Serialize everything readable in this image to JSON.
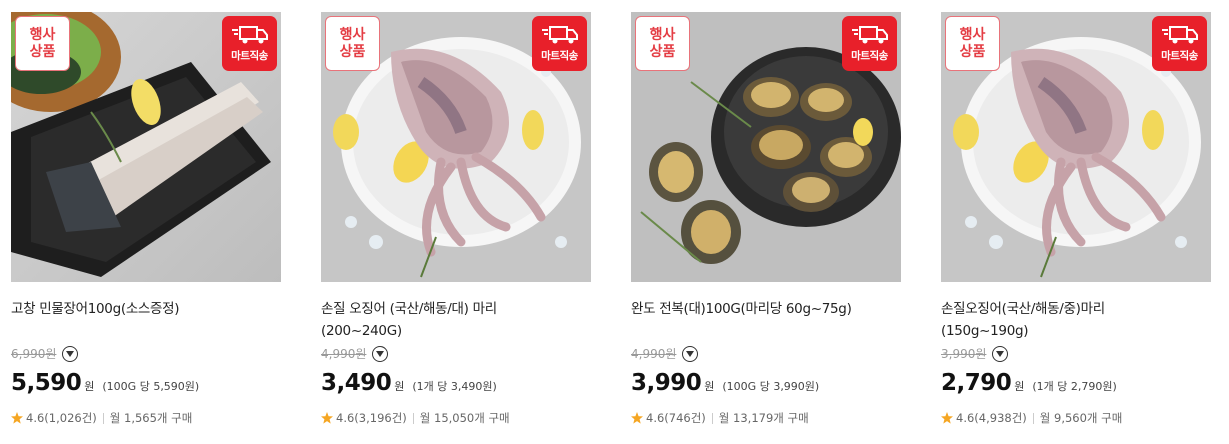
{
  "products": [
    {
      "event_label": [
        "행사",
        "상품"
      ],
      "delivery_label": "마트직송",
      "image": "grilled-eel-photo",
      "title": [
        "고창 민물장어100g(소스증정)"
      ],
      "original_price": "6,990",
      "won_strike": "원",
      "price": "5,590",
      "won": "원",
      "unit_price": "(100G 당 5,590원)",
      "rating": "4.6(1,026건)",
      "monthly": "월 1,565개 구매"
    },
    {
      "event_label": [
        "행사",
        "상품"
      ],
      "delivery_label": "마트직송",
      "image": "squid-on-ice-photo",
      "title": [
        "손질 오징어 (국산/해동/대) 마리",
        "(200~240G)"
      ],
      "original_price": "4,990",
      "won_strike": "원",
      "price": "3,490",
      "won": "원",
      "unit_price": "(1개 당 3,490원)",
      "rating": "4.6(3,196건)",
      "monthly": "월 15,050개 구매"
    },
    {
      "event_label": [
        "행사",
        "상품"
      ],
      "delivery_label": "마트직송",
      "image": "abalone-bowl-photo",
      "title": [
        "완도 전복(대)100G(마리당 60g~75g)"
      ],
      "original_price": "4,990",
      "won_strike": "원",
      "price": "3,990",
      "won": "원",
      "unit_price": "(100G 당 3,990원)",
      "rating": "4.6(746건)",
      "monthly": "월 13,179개 구매"
    },
    {
      "event_label": [
        "행사",
        "상품"
      ],
      "delivery_label": "마트직송",
      "image": "squid-on-ice-photo",
      "title": [
        "손질오징어(국산/해동/중)마리",
        "(150g~190g)"
      ],
      "original_price": "3,990",
      "won_strike": "원",
      "price": "2,790",
      "won": "원",
      "unit_price": "(1개 당 2,790원)",
      "rating": "4.6(4,938건)",
      "monthly": "월 9,560개 구매"
    }
  ],
  "colors": {
    "delivery_badge": "#e8202a",
    "event_badge_text": "#e43d44",
    "star": "#f5a623",
    "photo_bg": "#c9c9c9"
  },
  "icons": {
    "star": "star-icon",
    "truck": "truck-icon",
    "info": "chevron-down-icon"
  }
}
